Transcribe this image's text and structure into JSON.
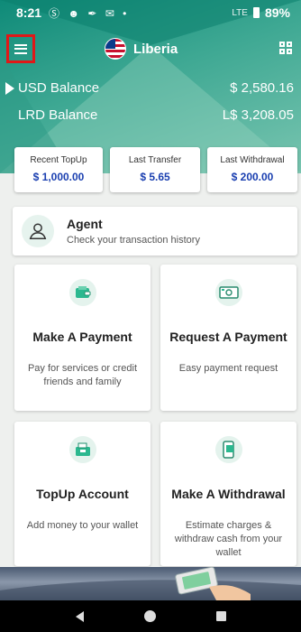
{
  "status_bar": {
    "time": "8:21",
    "icons": "Ⓢ ☻ ✒ ✉ •",
    "network": "LTE",
    "battery": "89%"
  },
  "header": {
    "country": "Liberia"
  },
  "balances": [
    {
      "label": "USD Balance",
      "value": "$ 2,580.16"
    },
    {
      "label": "LRD Balance",
      "value": "L$ 3,208.05"
    }
  ],
  "stats": [
    {
      "title": "Recent TopUp",
      "value": "$ 1,000.00"
    },
    {
      "title": "Last Transfer",
      "value": "$ 5.65"
    },
    {
      "title": "Last Withdrawal",
      "value": "$ 200.00"
    }
  ],
  "agent": {
    "title": "Agent",
    "subtitle": "Check your transaction history"
  },
  "actions": [
    {
      "title": "Make A Payment",
      "desc": "Pay for services or credit friends and family"
    },
    {
      "title": "Request A Payment",
      "desc": "Easy payment request"
    },
    {
      "title": "TopUp Account",
      "desc": "Add money to your wallet"
    },
    {
      "title": "Make A Withdrawal",
      "desc": "Estimate charges & withdraw cash from your wallet"
    }
  ],
  "colors": {
    "accent": "#1f9c84",
    "value_blue": "#1a3fb0",
    "highlight": "#e01818"
  }
}
